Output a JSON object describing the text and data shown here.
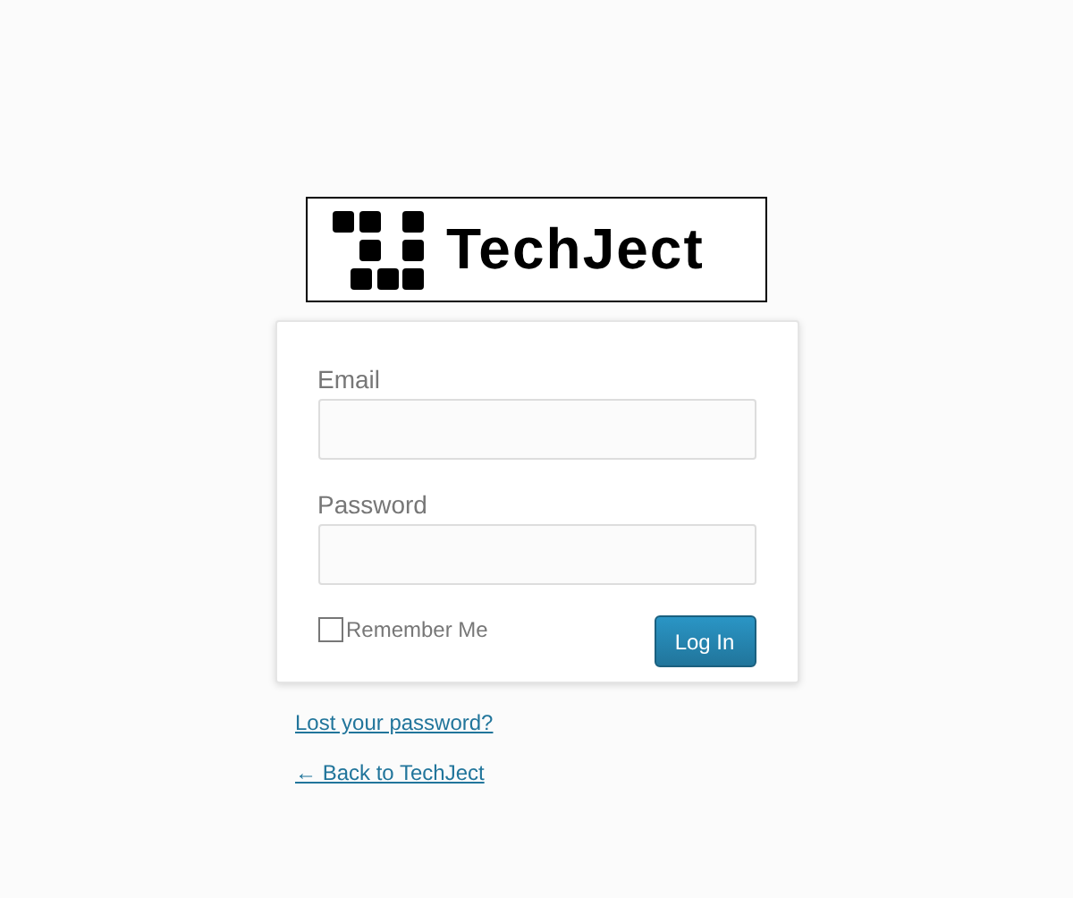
{
  "logo": {
    "text": "TechJect"
  },
  "form": {
    "fields": [
      {
        "label": "Email"
      },
      {
        "label": "Password"
      }
    ],
    "remember": {
      "label": "Remember Me",
      "checked": false
    },
    "submit": "Log In"
  },
  "links": [
    {
      "text": "Lost your password?"
    },
    {
      "text": "← Back to TechJect"
    }
  ]
}
